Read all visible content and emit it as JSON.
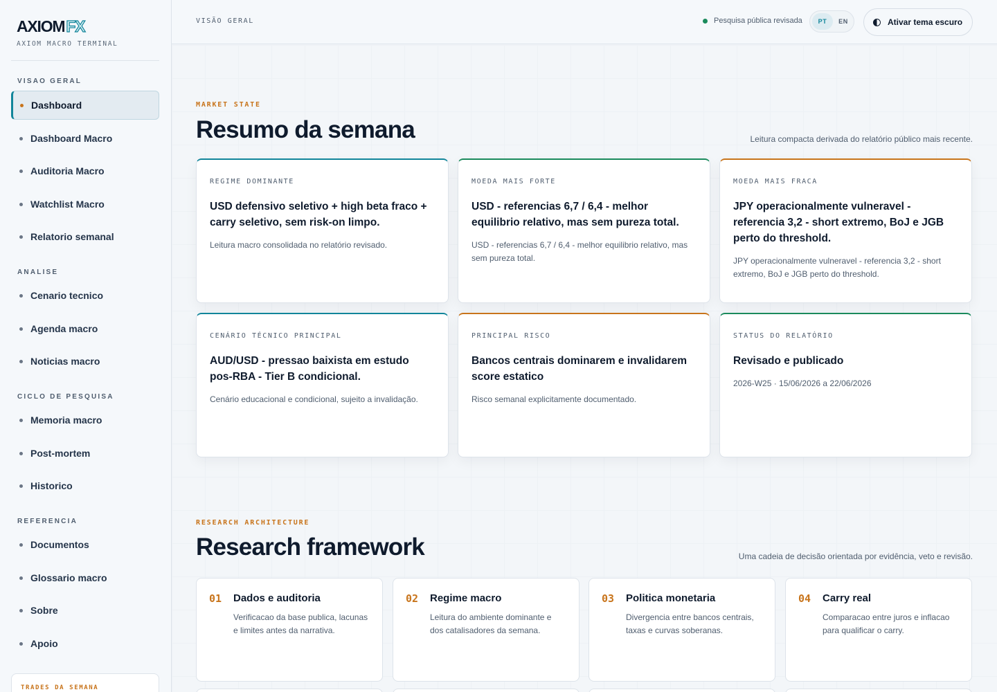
{
  "brand": {
    "name": "AXIOM",
    "suffix": "FX",
    "subtitle": "AXIOM MACRO TERMINAL"
  },
  "sidebar": {
    "sections": [
      {
        "title": "VISAO GERAL",
        "items": [
          "Dashboard",
          "Dashboard Macro",
          "Auditoria Macro",
          "Watchlist Macro",
          "Relatorio semanal"
        ]
      },
      {
        "title": "ANALISE",
        "items": [
          "Cenario tecnico",
          "Agenda macro",
          "Noticias macro"
        ]
      },
      {
        "title": "CICLO DE PESQUISA",
        "items": [
          "Memoria macro",
          "Post-mortem",
          "Historico"
        ]
      },
      {
        "title": "REFERENCIA",
        "items": [
          "Documentos",
          "Glossario macro",
          "Sobre",
          "Apoio"
        ]
      }
    ],
    "active_item": "Dashboard",
    "trades_title": "TRADES DA SEMANA"
  },
  "topbar": {
    "breadcrumb": "VISÃO GERAL",
    "status_text": "Pesquisa pública revisada",
    "lang_pt": "PT",
    "lang_en": "EN",
    "theme_button": "Ativar tema escuro"
  },
  "summary": {
    "eyebrow": "MARKET STATE",
    "title": "Resumo da semana",
    "note": "Leitura compacta derivada do relatório público mais recente.",
    "cards": [
      {
        "label": "REGIME DOMINANTE",
        "title": "USD defensivo seletivo + high beta fraco + carry seletivo, sem risk-on limpo.",
        "desc": "Leitura macro consolidada no relatório revisado."
      },
      {
        "label": "MOEDA MAIS FORTE",
        "title": "USD - referencias 6,7 / 6,4 - melhor equilibrio relativo, mas sem pureza total.",
        "desc": "USD - referencias 6,7 / 6,4 - melhor equilibrio relativo, mas sem pureza total."
      },
      {
        "label": "MOEDA MAIS FRACA",
        "title": "JPY operacionalmente vulneravel - referencia 3,2 - short extremo, BoJ e JGB perto do threshold.",
        "desc": "JPY operacionalmente vulneravel - referencia 3,2 - short extremo, BoJ e JGB perto do threshold."
      },
      {
        "label": "CENÁRIO TÉCNICO PRINCIPAL",
        "title": "AUD/USD - pressao baixista em estudo pos-RBA - Tier B condicional.",
        "desc": "Cenário educacional e condicional, sujeito a invalidação."
      },
      {
        "label": "PRINCIPAL RISCO",
        "title": "Bancos centrais dominarem e invalidarem score estatico",
        "desc": "Risco semanal explicitamente documentado."
      },
      {
        "label": "STATUS DO RELATÓRIO",
        "title": "Revisado e publicado",
        "desc": "2026-W25 · 15/06/2026 a 22/06/2026"
      }
    ]
  },
  "framework": {
    "eyebrow": "RESEARCH ARCHITECTURE",
    "title": "Research framework",
    "note": "Uma cadeia de decisão orientada por evidência, veto e revisão.",
    "steps": [
      {
        "num": "01",
        "title": "Dados e auditoria",
        "desc": "Verificacao da base publica, lacunas e limites antes da narrativa."
      },
      {
        "num": "02",
        "title": "Regime macro",
        "desc": "Leitura do ambiente dominante e dos catalisadores da semana."
      },
      {
        "num": "03",
        "title": "Politica monetaria",
        "desc": "Divergencia entre bancos centrais, taxas e curvas soberanas."
      },
      {
        "num": "04",
        "title": "Carry real",
        "desc": "Comparacao entre juros e inflacao para qualificar o carry."
      }
    ]
  },
  "colors": {
    "accent": "#11859a",
    "highlight": "#c8741b",
    "positive": "#1a8a5c",
    "ink": "#0f1b2d"
  }
}
